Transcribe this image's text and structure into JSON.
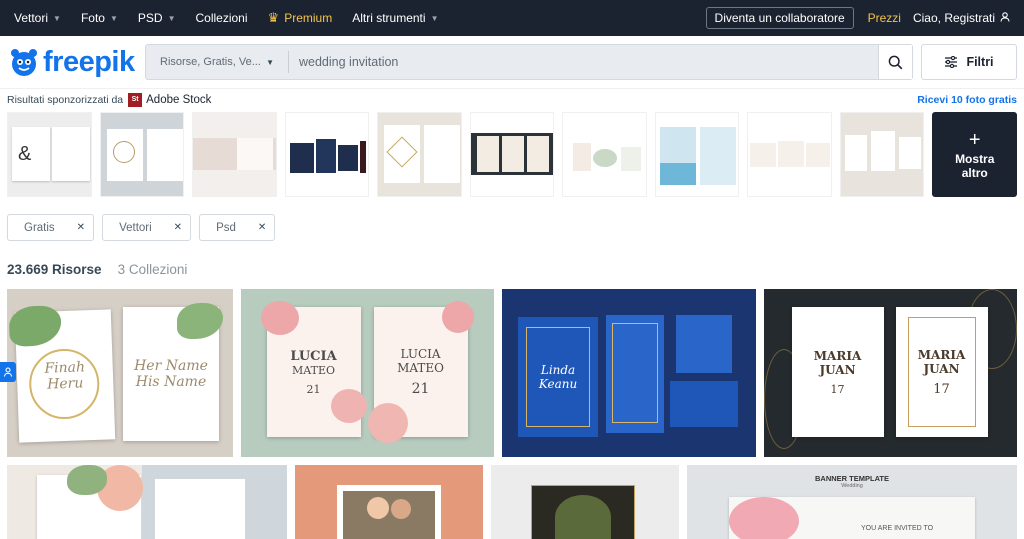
{
  "topnav": {
    "items": [
      {
        "label": "Vettori"
      },
      {
        "label": "Foto"
      },
      {
        "label": "PSD"
      },
      {
        "label": "Collezioni"
      }
    ],
    "premium": "Premium",
    "altri": "Altri strumenti",
    "collab": "Diventa un collaboratore",
    "prezzi": "Prezzi",
    "login": "Ciao, Registrati"
  },
  "logo": "freepik",
  "search": {
    "type": "Risorse, Gratis, Ve...",
    "query": "wedding invitation"
  },
  "filters_button": "Filtri",
  "sponsor": {
    "label": "Risultati sponzorizzati da",
    "brand": "Adobe Stock",
    "brand_badge": "St",
    "cta": "Ricevi 10 foto gratis",
    "more": "Mostra altro"
  },
  "chips": [
    {
      "label": "Gratis"
    },
    {
      "label": "Vettori"
    },
    {
      "label": "Psd"
    }
  ],
  "results": {
    "count": "23.669 Risorse",
    "collections": "3 Collezioni"
  },
  "tiles": [
    {
      "names": [
        "Finah",
        "Heru"
      ],
      "names2": [
        "Her Name",
        "His Name"
      ],
      "bg": "#d6cfc6"
    },
    {
      "names": [
        "LUCIA",
        "MATEO"
      ],
      "date": "21",
      "bg": "#b7ccbf"
    },
    {
      "names": [
        "Linda",
        "Keanu"
      ],
      "bg": "#1a3570"
    },
    {
      "names": [
        "MARIA",
        "JUAN"
      ],
      "date": "17",
      "bg": "#252a2e"
    }
  ],
  "tiles2": [
    {
      "label": "",
      "bg": "#efe9e4"
    },
    {
      "label": "",
      "bg": "#e4997a"
    },
    {
      "label": "",
      "bg": "#ececec"
    },
    {
      "label": "BANNER TEMPLATE",
      "sub": "Wedding",
      "invite": "YOU ARE INVITED TO",
      "bg": "#dfe3e6"
    }
  ]
}
